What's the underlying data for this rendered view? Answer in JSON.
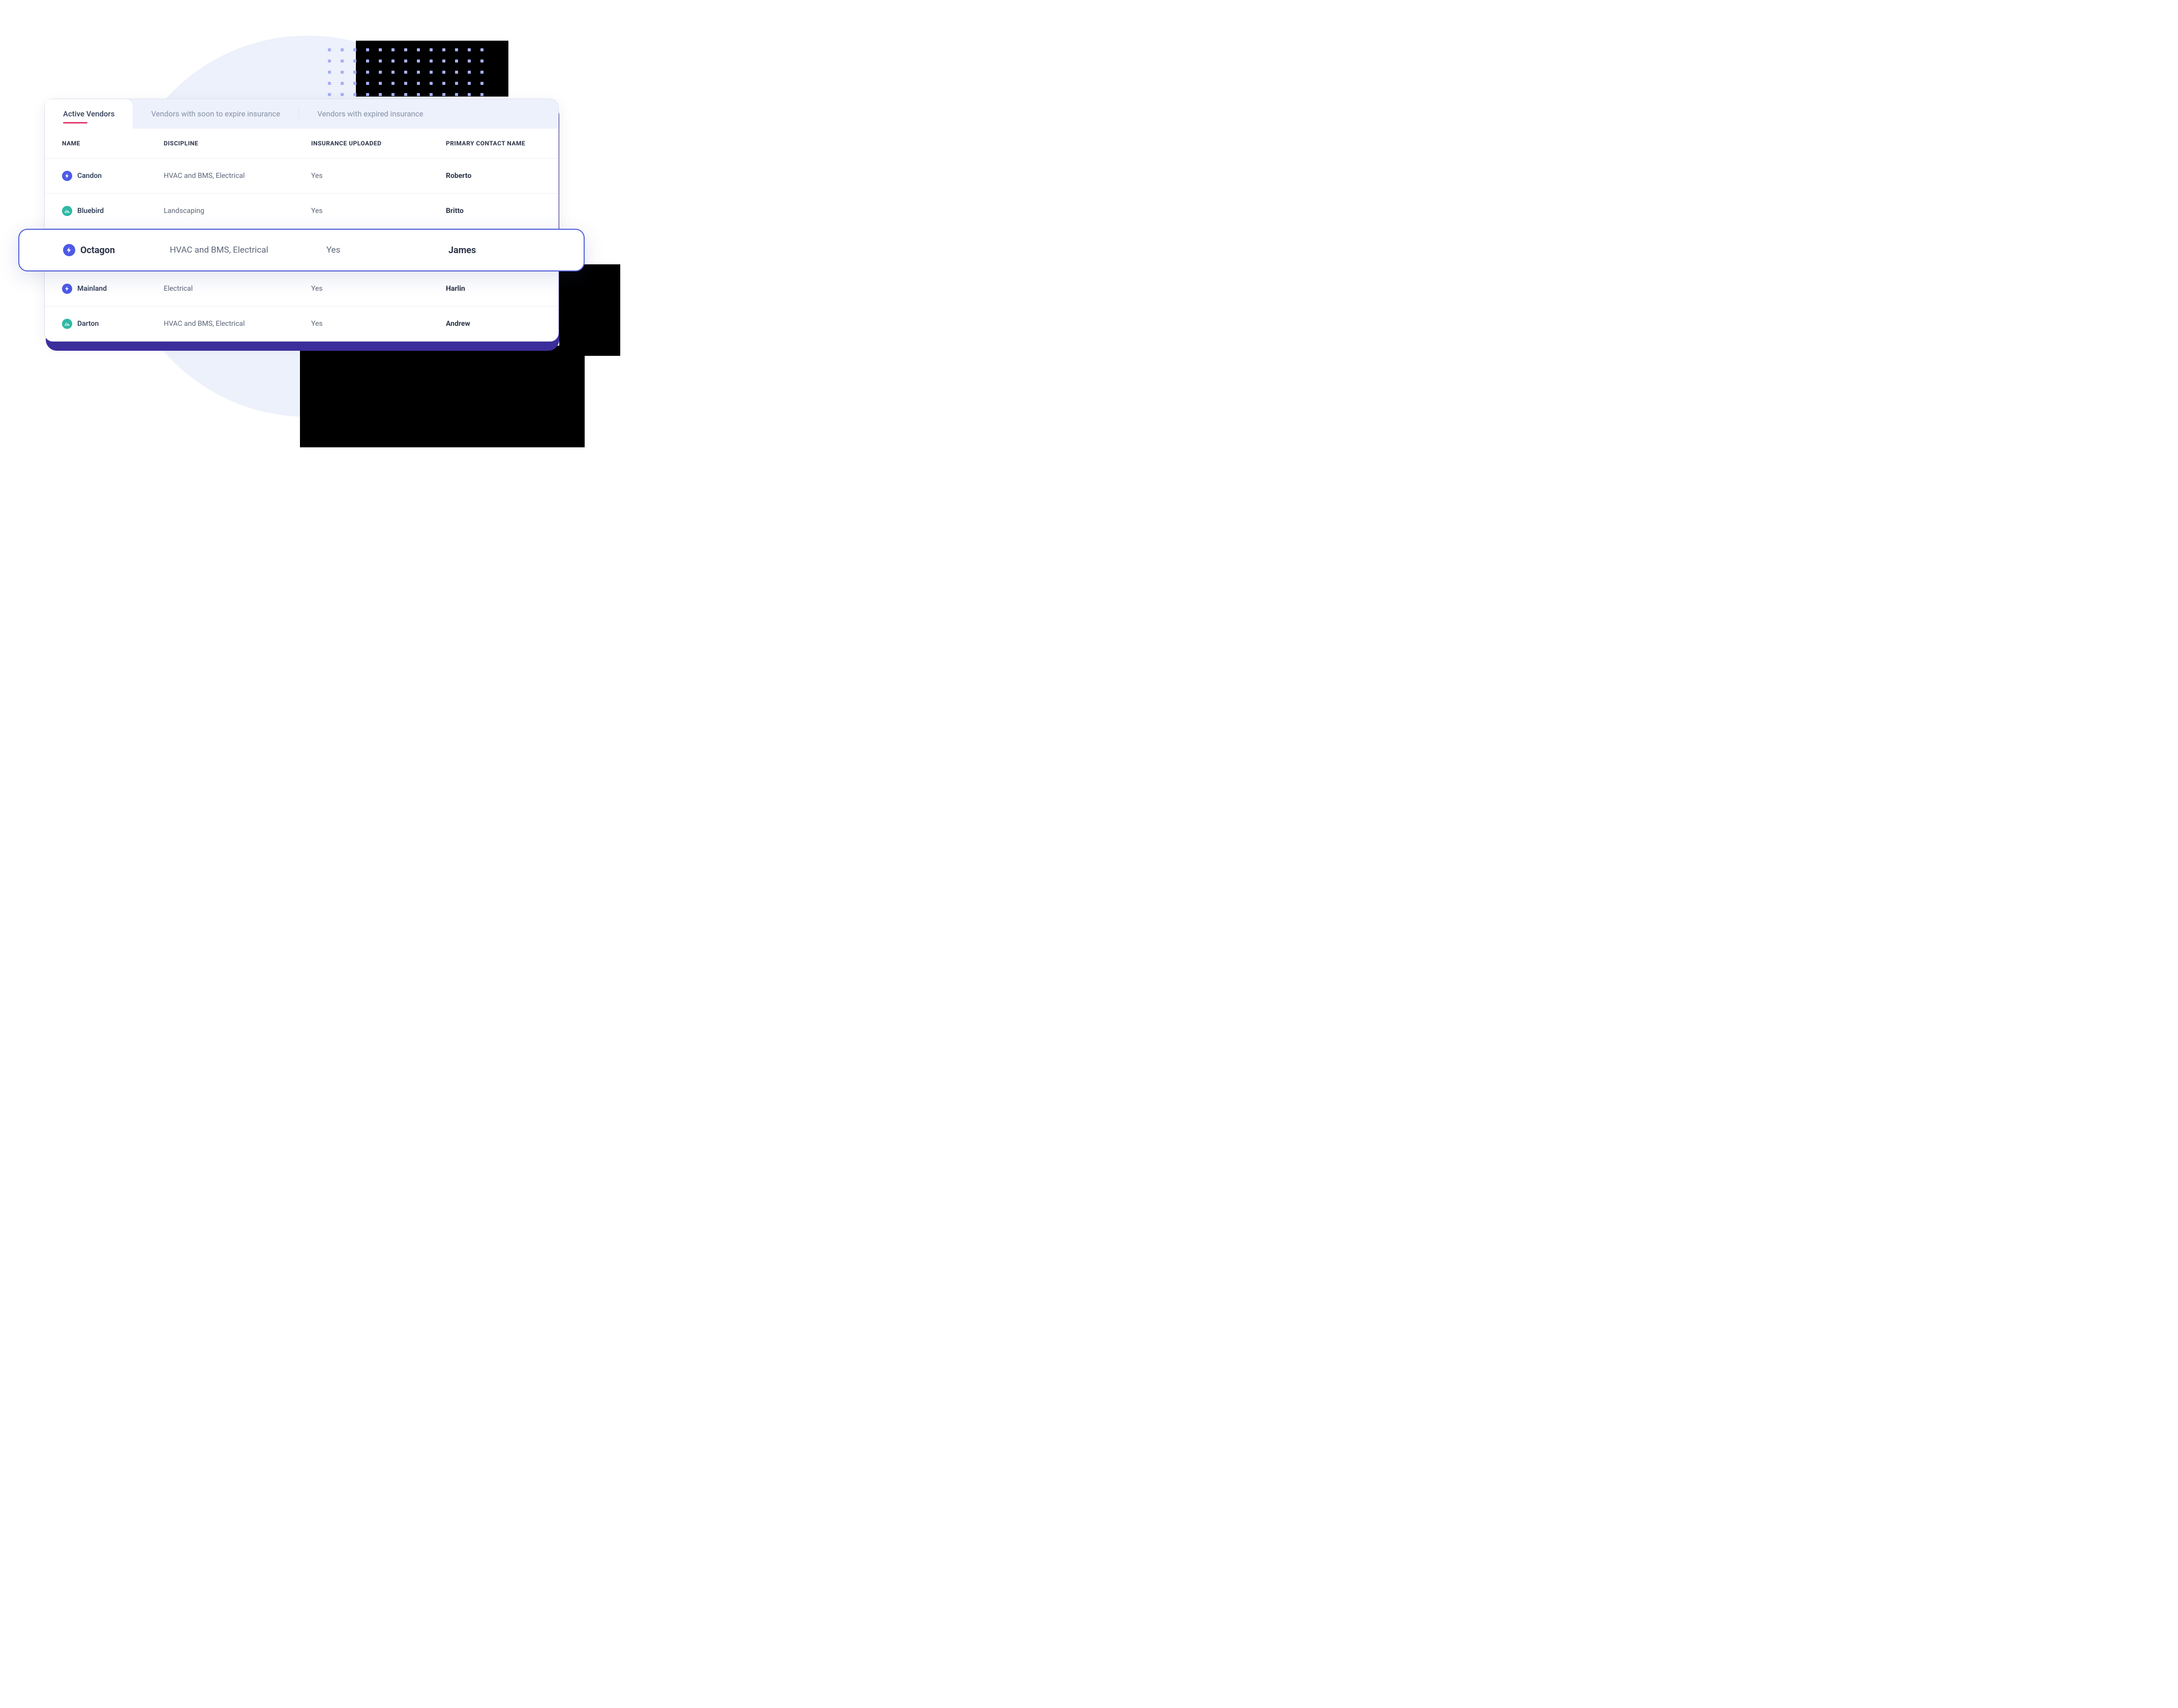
{
  "tabs": [
    {
      "label": "Active Vendors",
      "active": true
    },
    {
      "label": "Vendors with soon to expire insurance",
      "active": false
    },
    {
      "label": "Vendors with expired insurance",
      "active": false
    }
  ],
  "columns": {
    "name": "NAME",
    "discipline": "DISCIPLINE",
    "insurance_uploaded": "INSURANCE UPLOADED",
    "primary_contact": "PRIMARY CONTACT NAME"
  },
  "rows": [
    {
      "name": "Candon",
      "icon": "bolt",
      "discipline": "HVAC and BMS, Electrical",
      "insurance_uploaded": "Yes",
      "primary_contact": "Roberto",
      "highlight": false
    },
    {
      "name": "Bluebird",
      "icon": "mountain",
      "discipline": "Landscaping",
      "insurance_uploaded": "Yes",
      "primary_contact": "Britto",
      "highlight": false
    },
    {
      "name": "Octagon",
      "icon": "bolt",
      "discipline": "HVAC and BMS, Electrical",
      "insurance_uploaded": "Yes",
      "primary_contact": "James",
      "highlight": true
    },
    {
      "name": "Mainland",
      "icon": "bolt",
      "discipline": "Electrical",
      "insurance_uploaded": "Yes",
      "primary_contact": "Harlin",
      "highlight": false
    },
    {
      "name": "Darton",
      "icon": "mountain",
      "discipline": "HVAC and BMS, Electrical",
      "insurance_uploaded": "Yes",
      "primary_contact": "Andrew",
      "highlight": false
    }
  ],
  "colors": {
    "icon_blue": "#4c5ae6",
    "icon_teal": "#2fb8a6",
    "highlight_border": "#4f5fd9",
    "tab_underline": "#e43f72"
  }
}
